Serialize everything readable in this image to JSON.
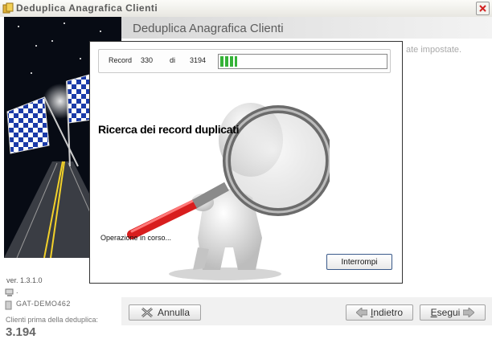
{
  "window": {
    "title": "Deduplica Anagrafica Clienti"
  },
  "left": {
    "version": "ver. 1.3.1.0",
    "pc_name": ".",
    "database": "GAT-DEMO462",
    "clients_label": "Clienti prima della deduplica:",
    "clients_count": "3.194"
  },
  "main": {
    "header_title": "Deduplica Anagrafica Clienti",
    "hint_text": "ate impostate."
  },
  "buttons": {
    "annulla": "Annulla",
    "indietro_underlined": "I",
    "indietro_rest": "ndietro",
    "esegui_underlined": "E",
    "esegui_rest": "segui"
  },
  "dialog": {
    "record_label": "Record",
    "record_current": "330",
    "record_of": "di",
    "record_total": "3194",
    "progress_fraction": 0.103,
    "heading": "Ricerca dei record duplicati",
    "status": "Operazione in corso...",
    "stop_button": "Interrompi"
  },
  "icons": {
    "app": "app-folder-icon",
    "close": "close-icon",
    "computer": "computer-icon",
    "database": "database-icon",
    "cancel": "cancel-x-icon",
    "back": "arrow-left-icon",
    "forward": "arrow-right-icon"
  },
  "colors": {
    "progress": "#35b238",
    "close_x": "#d22222",
    "magnifier_handle": "#d81e1e"
  }
}
